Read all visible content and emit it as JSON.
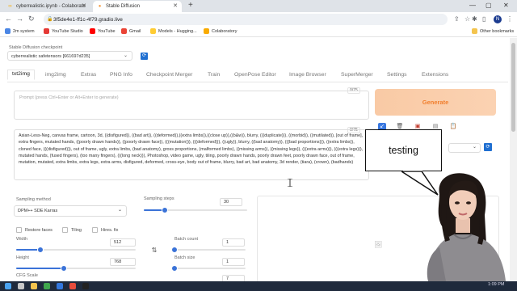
{
  "browser": {
    "tabs": [
      {
        "title": "cyberrealistic.ipynb - Colaborato",
        "favicon": "colab-icon"
      },
      {
        "title": "Stable Diffusion",
        "favicon": "sd-icon"
      }
    ],
    "new_tab": "+",
    "url": "3f5de4e1-ff1c-4f79.gradio.live",
    "profile_initial": "N",
    "bookmarks": [
      "2m system",
      "YouTube Studio",
      "YouTube",
      "Gmail",
      "Models - Hugging...",
      "Colaboratory"
    ],
    "other_bookmarks": "Other bookmarks"
  },
  "checkpoint": {
    "label": "Stable Diffusion checkpoint",
    "value": "cyberrealistic safetensors [661697d235]"
  },
  "tabs": [
    "txt2img",
    "img2img",
    "Extras",
    "PNG Info",
    "Checkpoint Merger",
    "Train",
    "OpenPose Editor",
    "Image Browser",
    "SuperMerger",
    "Settings",
    "Extensions"
  ],
  "prompt": {
    "placeholder": "Prompt (press Ctrl+Enter or Alt+Enter to generate)",
    "counter": "0/75"
  },
  "generate_label": "Generate",
  "negative_prompt": {
    "counter": "0/75",
    "text": "Asian-Less-Neg, canvas frame, cartoon, 3d, ((disfigured)), ((bad art)), ((deformed)),((extra limbs)),((close up)),((b&w)), blurry, (((duplicate))), ((morbid)), ((mutilated)), [out of frame], extra fingers, mutated hands, ((poorly drawn hands)), ((poorly drawn face)), (((mutation))), (((deformed))), ((ugly)), blurry, ((bad anatomy)), (((bad proportions))), ((extra limbs)), cloned face, (((disfigured))), out of frame, ugly, extra limbs, (bad anatomy), gross proportions, (malformed limbs), ((missing arms)), ((missing legs)), (((extra arms))), (((extra legs))), mutated hands, (fused fingers), (too many fingers), (((long neck))), Photoshop, video game, ugly, tiling, poorly drawn hands, poorly drawn feet, poorly drawn face, out of frame, mutation, mutated, extra limbs, extra legs, extra arms, disfigured, deformed, cross-eye, body out of frame, blurry, bad art, bad anatomy, 3d render, (tiara), (crown), (badhands)"
  },
  "sampling": {
    "method_label": "Sampling method",
    "method_value": "DPM++ SDE Karras",
    "steps_label": "Sampling steps",
    "steps_value": "30",
    "steps_fraction": 0.2
  },
  "options": {
    "restore_faces": "Restore faces",
    "tiling": "Tiling",
    "hires_fix": "Hires. fix"
  },
  "dimensions": {
    "width_label": "Width",
    "width_value": "512",
    "width_fraction": 0.2,
    "height_label": "Height",
    "height_value": "768",
    "height_fraction": 0.4
  },
  "batch": {
    "count_label": "Batch count",
    "count_value": "1",
    "size_label": "Batch size",
    "size_value": "1"
  },
  "cfg": {
    "label": "CFG Scale",
    "value": "7"
  },
  "overlay": {
    "bubble_text": "testing"
  },
  "taskbar": {
    "clock": "1:09 PM"
  }
}
